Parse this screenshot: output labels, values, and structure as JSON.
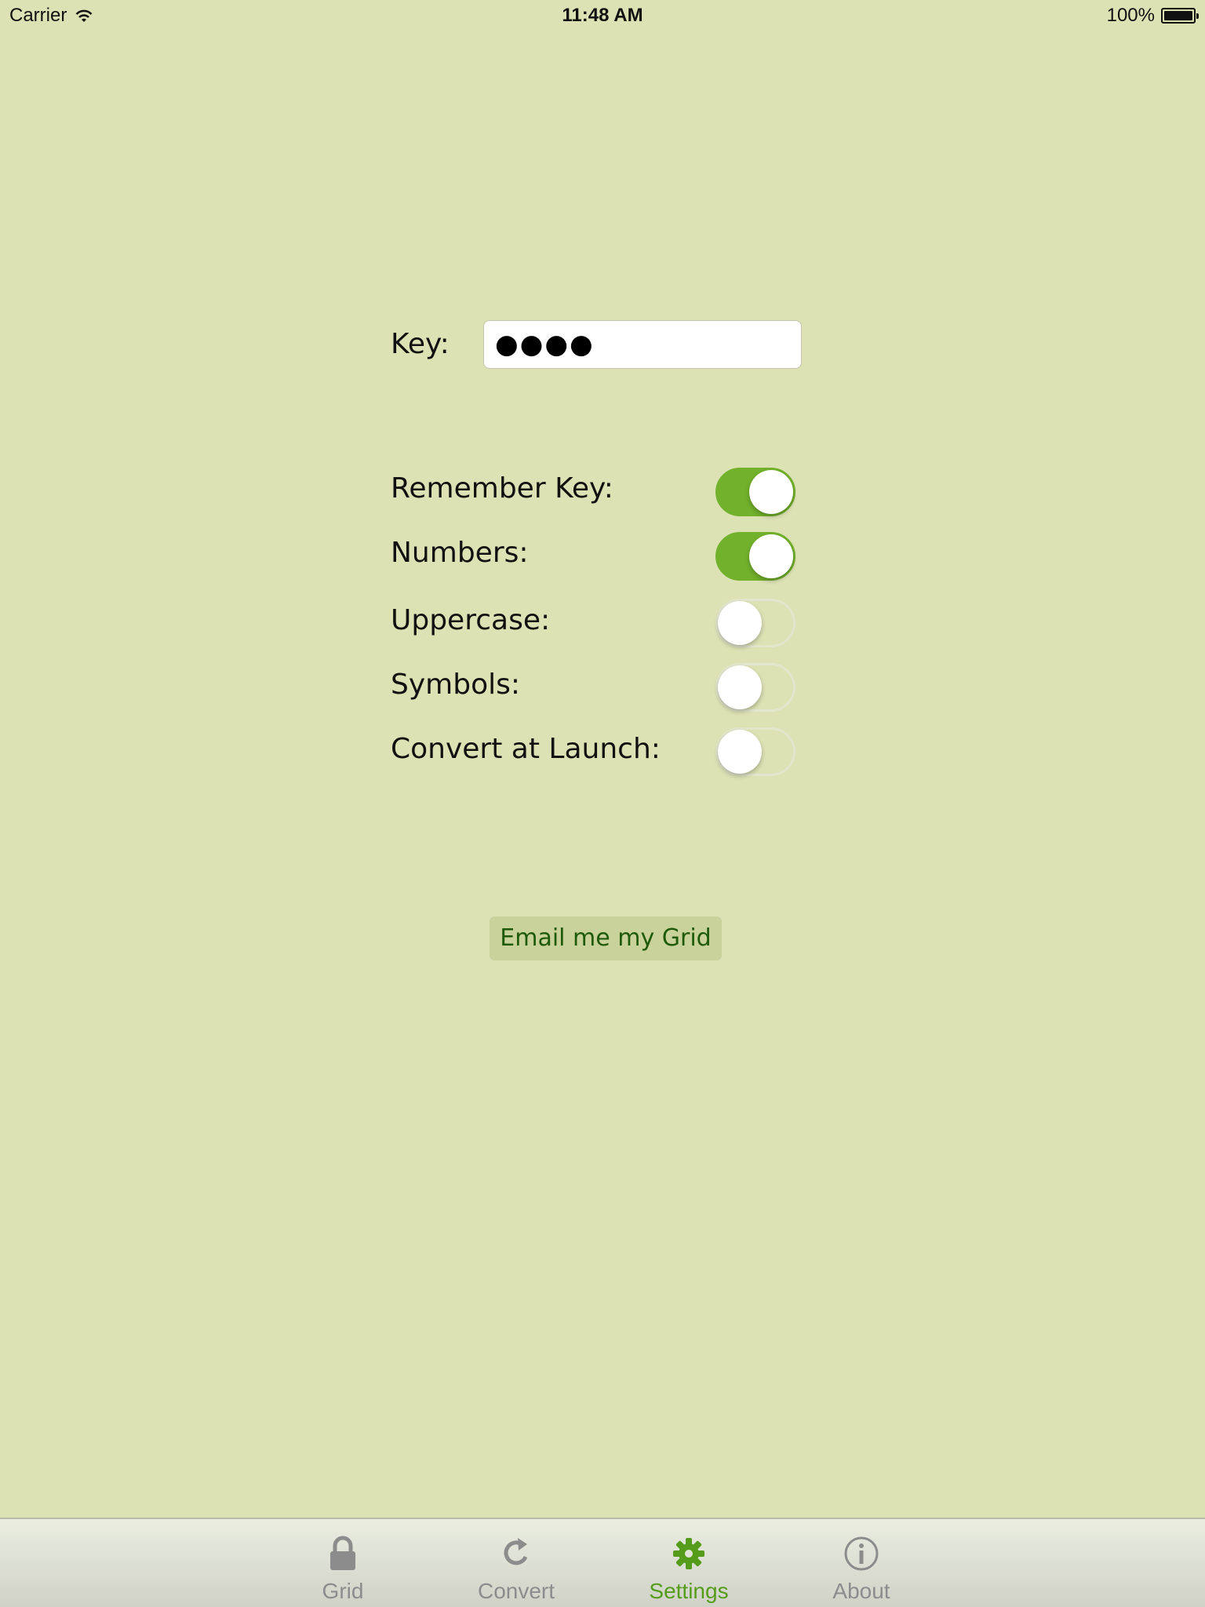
{
  "status_bar": {
    "carrier": "Carrier",
    "time": "11:48 AM",
    "battery": "100%"
  },
  "key": {
    "label": "Key:",
    "value": "●●●●"
  },
  "settings": [
    {
      "label": "Remember Key:",
      "on": true
    },
    {
      "label": "Numbers:",
      "on": true
    },
    {
      "label": "Uppercase:",
      "on": false
    },
    {
      "label": "Symbols:",
      "on": false
    },
    {
      "label": "Convert at Launch:",
      "on": false
    }
  ],
  "email_button": "Email me my Grid",
  "tabs": [
    {
      "label": "Grid",
      "icon": "lock-icon",
      "active": false
    },
    {
      "label": "Convert",
      "icon": "refresh-icon",
      "active": false
    },
    {
      "label": "Settings",
      "icon": "gear-icon",
      "active": true
    },
    {
      "label": "About",
      "icon": "info-icon",
      "active": false
    }
  ],
  "colors": {
    "background": "#dce2b4",
    "switch_on": "#72b12b",
    "tab_active": "#559c1a",
    "tab_inactive": "#8c8c8c"
  }
}
